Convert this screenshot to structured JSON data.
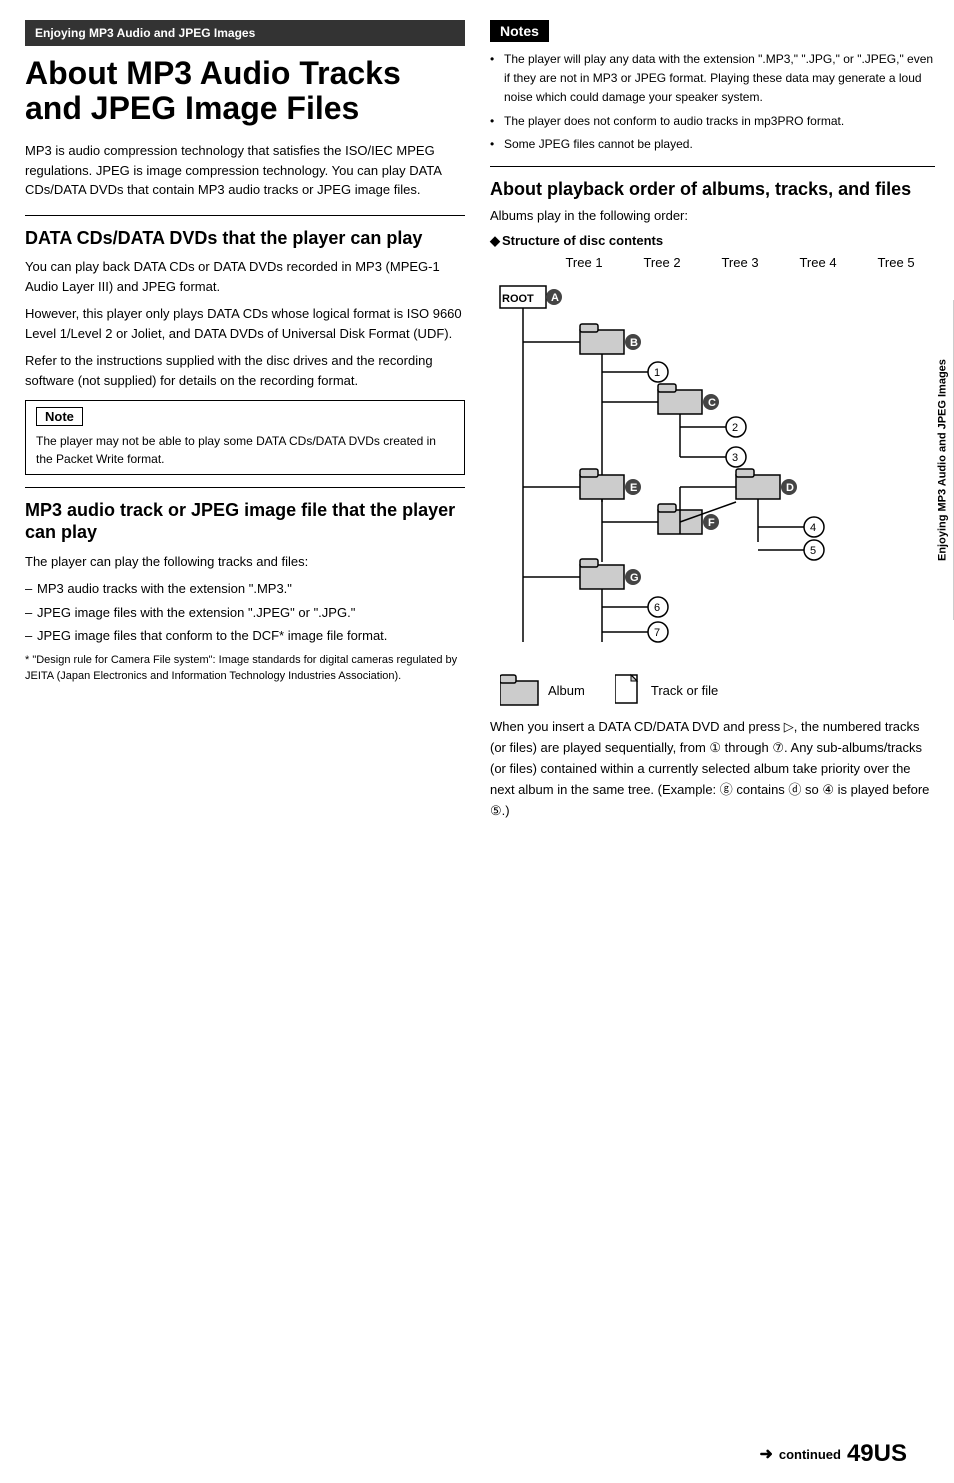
{
  "breadcrumb": "Enjoying MP3 Audio and JPEG Images",
  "main_title": "About MP3 Audio Tracks and JPEG Image Files",
  "intro_text": "MP3 is audio compression technology that satisfies the ISO/IEC MPEG regulations. JPEG is image compression technology. You can play DATA CDs/DATA DVDs that contain MP3 audio tracks or JPEG image files.",
  "section1": {
    "title": "DATA CDs/DATA DVDs that the player can play",
    "body1": "You can play back DATA CDs or DATA DVDs recorded in MP3 (MPEG-1 Audio Layer III) and JPEG format.",
    "body2": "However, this player only plays DATA CDs whose logical format is ISO 9660 Level 1/Level 2 or Joliet, and DATA DVDs of Universal Disk Format (UDF).",
    "body3": "Refer to the instructions supplied with the disc drives and the recording software (not supplied) for details on the recording format.",
    "note_title": "Note",
    "note_text": "The player may not be able to play some DATA CDs/DATA DVDs created in the Packet Write format."
  },
  "section2": {
    "title": "MP3 audio track or JPEG image file that the player can play",
    "intro": "The player can play the following tracks and files:",
    "items": [
      "MP3 audio tracks with the extension \".MP3.\"",
      "JPEG image files with the extension \".JPEG\" or \".JPG.\"",
      "JPEG image files that conform to the DCF* image file format."
    ],
    "footnote": "* \"Design rule for Camera File system\": Image standards for digital cameras regulated by JEITA (Japan Electronics and Information Technology Industries Association)."
  },
  "right_notes": {
    "title": "Notes",
    "items": [
      "The player will play any data with the extension \".MP3,\" \".JPG,\" or \".JPEG,\" even if they are not in MP3 or JPEG format. Playing these data may generate a loud noise which could damage your speaker system.",
      "The player does not conform to audio tracks in mp3PRO format.",
      "Some JPEG files cannot be played."
    ]
  },
  "section3": {
    "title": "About playback order of albums, tracks, and files",
    "intro": "Albums play in the following order:",
    "structure_label": "Structure of disc contents",
    "tree_headers": [
      "Tree 1",
      "Tree 2",
      "Tree 3",
      "Tree 4",
      "Tree 5"
    ],
    "legend": {
      "album_label": "Album",
      "file_label": "Track or file"
    }
  },
  "playback_text": "When you insert a DATA CD/DATA DVD and press ▷, the numbered tracks (or files) are played sequentially, from ① through ⑦. Any sub-albums/tracks (or files) contained within a currently selected album take priority over the next album in the same tree. (Example: ⓖ contains ⓓ so ④ is played before ⑤.)",
  "sidebar_label": "Enjoying MP3 Audio and JPEG Images",
  "bottom": {
    "continued": "continued",
    "page_number": "49US"
  }
}
